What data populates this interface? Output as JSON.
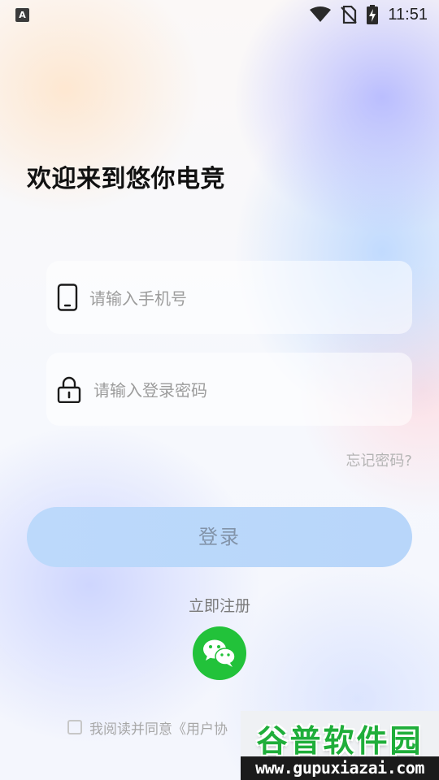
{
  "status_bar": {
    "app_indicator": "A",
    "time": "11:51",
    "icons": [
      "wifi-icon",
      "no-sim-icon",
      "battery-charging-icon"
    ]
  },
  "welcome": {
    "title": "欢迎来到悠你电竞"
  },
  "login_form": {
    "phone_placeholder": "请输入手机号",
    "password_placeholder": "请输入登录密码",
    "forgot_password": "忘记密码?",
    "login_button": "登录"
  },
  "register_link": "立即注册",
  "third_party": {
    "wechat_icon": "wechat-icon",
    "wechat_color": "#22C23A"
  },
  "agreement": {
    "text": "我阅读并同意《用户协",
    "checked": false
  },
  "watermark": {
    "title": "谷普软件园",
    "url": "www.gupuxiazai.com"
  },
  "colors": {
    "login_button_bg": "#B8D6FA",
    "login_button_text": "#8293A8",
    "placeholder": "#9C9C9C"
  }
}
